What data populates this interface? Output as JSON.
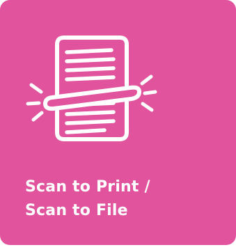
{
  "tile": {
    "label_line1": "Scan to Print /",
    "label_line2": "Scan to File",
    "background_color": "#e1549d",
    "foreground_color": "#ffffff",
    "icon": "document-scanner-icon"
  }
}
